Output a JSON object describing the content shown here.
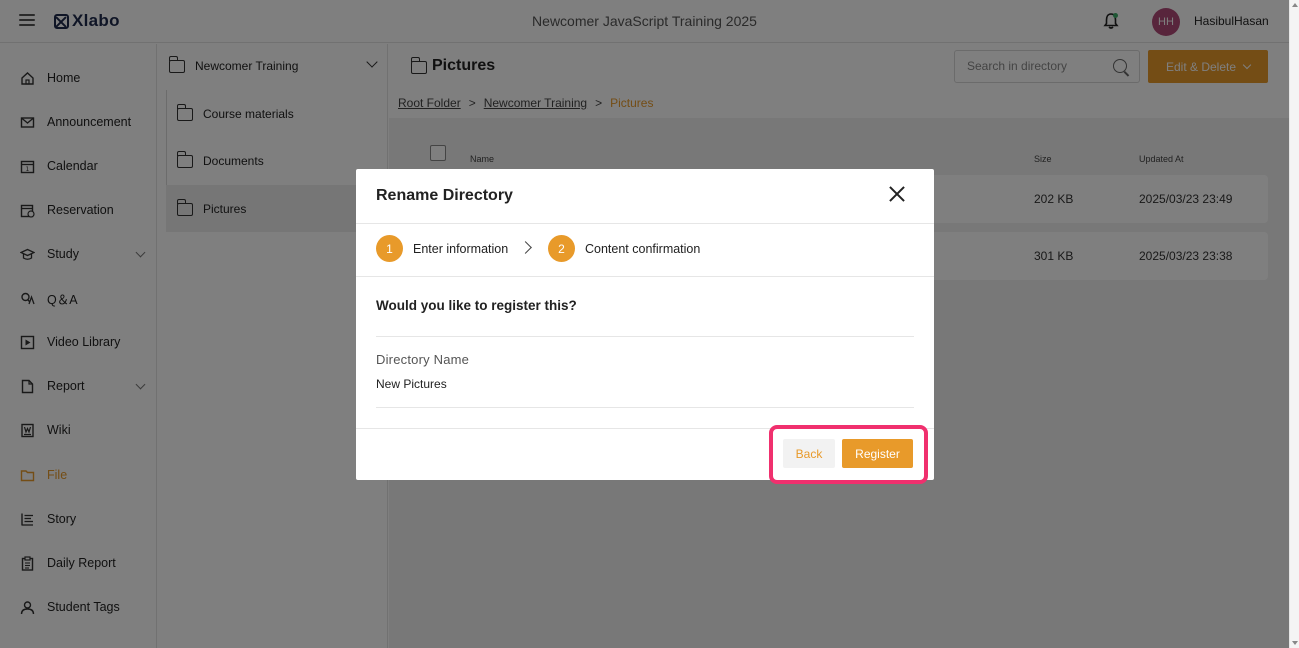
{
  "header": {
    "logo_text": "Xlabo",
    "title": "Newcomer JavaScript Training 2025",
    "avatar_initials": "HH",
    "username": "HasibulHasan"
  },
  "sidebar": {
    "items": [
      {
        "label": "Home",
        "icon": "home-icon"
      },
      {
        "label": "Announcement",
        "icon": "mail-icon"
      },
      {
        "label": "Calendar",
        "icon": "calendar-icon"
      },
      {
        "label": "Reservation",
        "icon": "reservation-icon"
      },
      {
        "label": "Study",
        "icon": "graduation-cap-icon",
        "expandable": true
      },
      {
        "label": "Q＆A",
        "icon": "qa-icon"
      },
      {
        "label": "Video Library",
        "icon": "video-icon"
      },
      {
        "label": "Report",
        "icon": "report-icon",
        "expandable": true
      },
      {
        "label": "Wiki",
        "icon": "wiki-icon"
      },
      {
        "label": "File",
        "icon": "folder-icon",
        "active": true
      },
      {
        "label": "Story",
        "icon": "story-icon"
      },
      {
        "label": "Daily Report",
        "icon": "clipboard-icon"
      },
      {
        "label": "Student Tags",
        "icon": "user-icon"
      }
    ]
  },
  "tree": {
    "root": "Newcomer Training",
    "items": [
      "Course materials",
      "Documents",
      "Pictures"
    ],
    "selected": "Pictures"
  },
  "main": {
    "title": "Pictures",
    "search_placeholder": "Search in directory",
    "edit_button": "Edit & Delete",
    "breadcrumb": {
      "root": "Root Folder",
      "sep": ">",
      "parent": "Newcomer Training",
      "current": "Pictures"
    },
    "columns": {
      "name": "Name",
      "size": "Size",
      "updated": "Updated At"
    },
    "rows": [
      {
        "size": "202 KB",
        "updated": "2025/03/23 23:49"
      },
      {
        "size": "301 KB",
        "updated": "2025/03/23 23:38"
      }
    ]
  },
  "modal": {
    "title": "Rename Directory",
    "steps": [
      {
        "num": "1",
        "label": "Enter information"
      },
      {
        "num": "2",
        "label": "Content confirmation"
      }
    ],
    "question": "Would you like to register this?",
    "field_label": "Directory Name",
    "field_value": "New Pictures",
    "back_label": "Back",
    "register_label": "Register"
  },
  "colors": {
    "accent": "#e89a2a",
    "highlight": "#f0306e",
    "avatar": "#b04a78",
    "logo": "#1f2a4d"
  }
}
